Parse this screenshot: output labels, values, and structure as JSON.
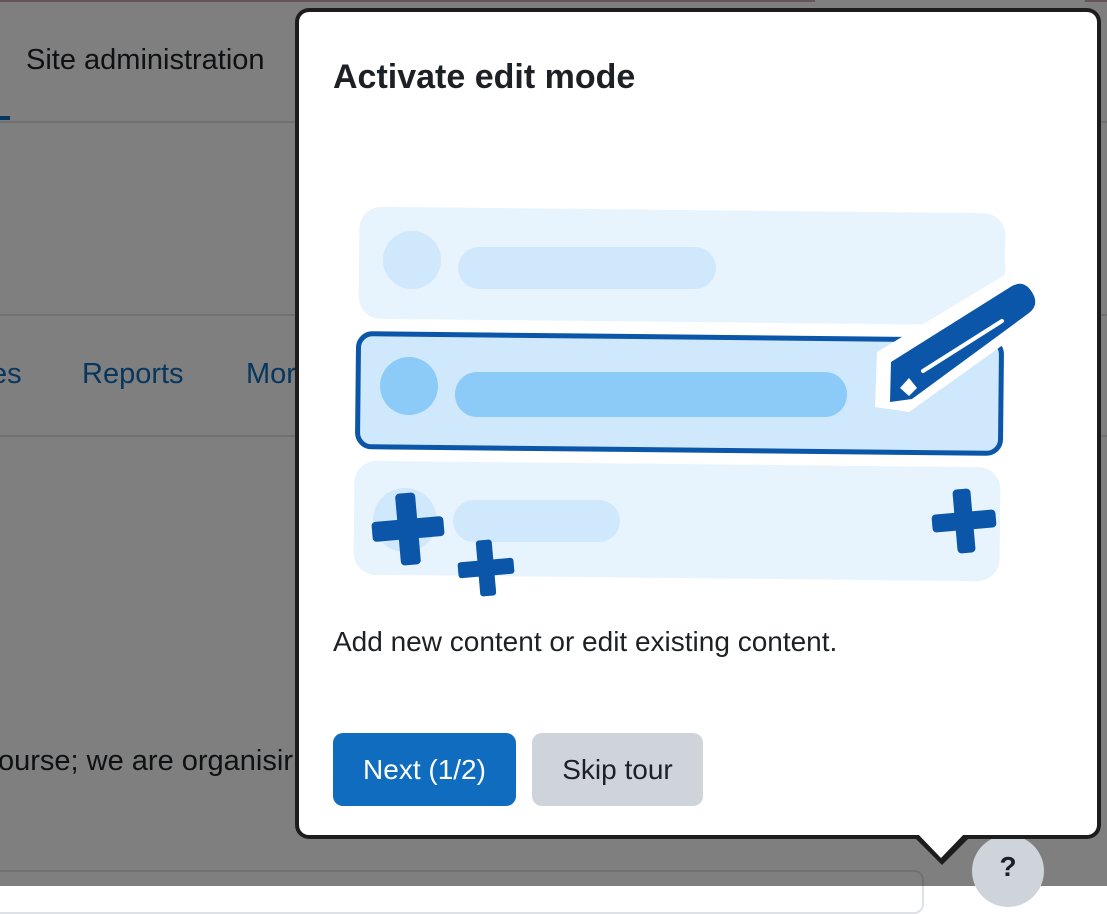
{
  "background": {
    "tabs": [
      "Site administration"
    ],
    "secondary_nav": [
      "es",
      "Reports",
      "Mor"
    ],
    "body_text": "ourse; we are organisir"
  },
  "tour": {
    "title": "Activate edit mode",
    "body": "Add new content or edit existing content.",
    "next_label": "Next (1/2)",
    "skip_label": "Skip tour",
    "step_current": 1,
    "step_total": 2,
    "illustration_icons": [
      "pencil-icon",
      "plus-icon"
    ]
  },
  "help_button": {
    "label": "?"
  },
  "colors": {
    "primary": "#0f6cbf",
    "secondary_button": "#ced4da",
    "text": "#1d2125",
    "illustration_light": "#e8f4fd",
    "illustration_mid": "#cfe8fb",
    "illustration_accent": "#8ccbf8",
    "illustration_dark": "#0b56a8"
  }
}
